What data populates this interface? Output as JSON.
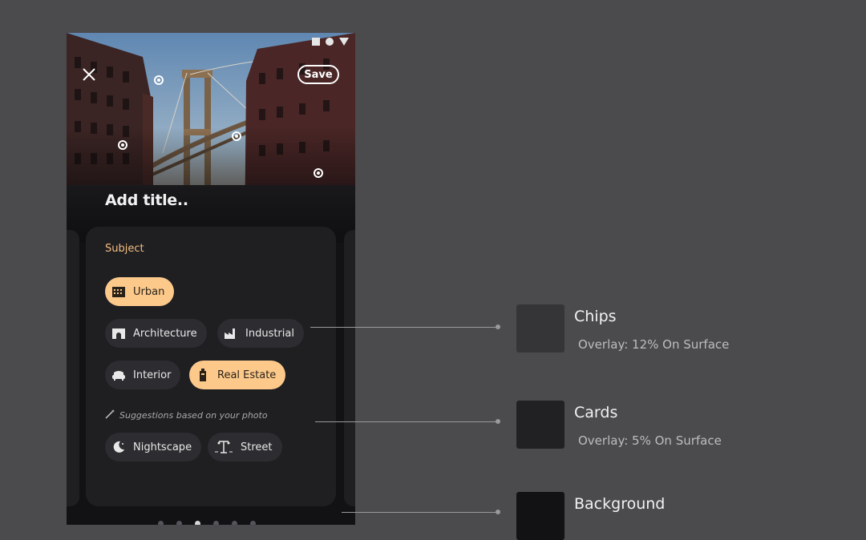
{
  "screen": {
    "save_label": "Save",
    "title_placeholder": "Add title..",
    "subject_label": "Subject",
    "chips": [
      {
        "label": "Urban",
        "selected": true,
        "icon": "building-icon"
      },
      {
        "label": "Architecture",
        "selected": false,
        "icon": "arch-icon"
      },
      {
        "label": "Industrial",
        "selected": false,
        "icon": "factory-icon"
      },
      {
        "label": "Interior",
        "selected": false,
        "icon": "armchair-icon"
      },
      {
        "label": "Real Estate",
        "selected": true,
        "icon": "house-icon"
      }
    ],
    "suggestion_text": "Suggestions based on your photo",
    "suggested_chips": [
      {
        "label": "Nightscape",
        "selected": false,
        "icon": "moon-icon"
      },
      {
        "label": "Street",
        "selected": false,
        "icon": "streetlight-icon"
      }
    ],
    "page_dots": 6,
    "active_dot": 3
  },
  "legend": [
    {
      "title": "Chips",
      "subtitle": "Overlay: 12% On Surface",
      "color": "#353437"
    },
    {
      "title": "Cards",
      "subtitle": "Overlay: 5% On Surface",
      "color": "#212023"
    },
    {
      "title": "Background",
      "subtitle": "",
      "color": "#121113"
    }
  ],
  "colors": {
    "page_bg": "#4b4a4d",
    "accent": "#f3be82",
    "chip_selected": "#fcc98b",
    "chip": "#2d2c30",
    "card": "#1f1e21",
    "background": "#121113"
  }
}
